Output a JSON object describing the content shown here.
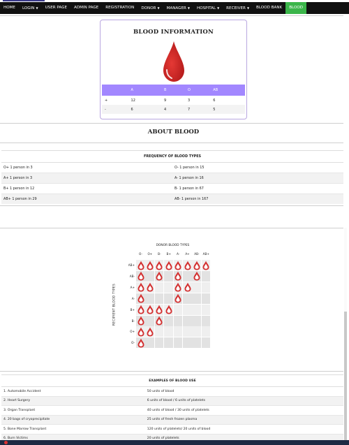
{
  "nav": {
    "items": [
      {
        "label": "HOME",
        "caret": false,
        "active": false
      },
      {
        "label": "LOGIN",
        "caret": true,
        "active": false
      },
      {
        "label": "USER PAGE",
        "caret": false,
        "active": false
      },
      {
        "label": "ADMIN PAGE",
        "caret": false,
        "active": false
      },
      {
        "label": "REGISTRATION",
        "caret": false,
        "active": false
      },
      {
        "label": "DONOR",
        "caret": true,
        "active": false
      },
      {
        "label": "MANAGER",
        "caret": true,
        "active": false
      },
      {
        "label": "HOSPITAL",
        "caret": true,
        "active": false
      },
      {
        "label": "RECEIVER",
        "caret": true,
        "active": false
      },
      {
        "label": "BLOOD BANK",
        "caret": false,
        "active": false
      },
      {
        "label": "BLOOD",
        "caret": false,
        "active": true
      }
    ],
    "active_color": "#3bb54a"
  },
  "info_card": {
    "title": "BLOOD INFORMATION",
    "headers": [
      "",
      "A",
      "B",
      "O",
      "AB"
    ],
    "rows": [
      [
        "+",
        "12",
        "9",
        "3",
        "6"
      ],
      [
        "-",
        "6",
        "4",
        "7",
        "5"
      ]
    ],
    "header_color": "#a287ff"
  },
  "about_title": "ABOUT BLOOD",
  "frequency": {
    "title": "FREQUENCY OF BLOOD TYPES",
    "rows": [
      [
        "O+ 1 person in 3",
        "O- 1 person in 15"
      ],
      [
        "A+ 1 person in 3",
        "A- 1 person in 16"
      ],
      [
        "B+ 1 person in 12",
        "B- 1 person in 67"
      ],
      [
        "AB+ 1 person in 29",
        "AB- 1 person in 167"
      ]
    ]
  },
  "compat": {
    "donor_title": "DONOR BLOOD TYPES",
    "recipient_title": "RECIPIENT BLOOD TYPES",
    "donor_types": [
      "O-",
      "O+",
      "B-",
      "B+",
      "A-",
      "A+",
      "AB-",
      "AB+"
    ],
    "recipient_types": [
      "AB+",
      "AB-",
      "A+",
      "A-",
      "B+",
      "B-",
      "O+",
      "O-"
    ],
    "matrix": [
      [
        1,
        1,
        1,
        1,
        1,
        1,
        1,
        1
      ],
      [
        1,
        0,
        1,
        0,
        1,
        0,
        1,
        0
      ],
      [
        1,
        1,
        0,
        0,
        1,
        1,
        0,
        0
      ],
      [
        1,
        0,
        0,
        0,
        1,
        0,
        0,
        0
      ],
      [
        1,
        1,
        1,
        1,
        0,
        0,
        0,
        0
      ],
      [
        1,
        0,
        1,
        0,
        0,
        0,
        0,
        0
      ],
      [
        1,
        1,
        0,
        0,
        0,
        0,
        0,
        0
      ],
      [
        1,
        0,
        0,
        0,
        0,
        0,
        0,
        0
      ]
    ],
    "drop_color": "#d32f2f"
  },
  "uses": {
    "title": "EXAMPLES OF BLOOD USE",
    "rows": [
      [
        "1. Automobile Accident",
        "50 units of blood"
      ],
      [
        "2. Heart Surgery",
        "6 units of blood / 6 units of platelets"
      ],
      [
        "3. Organ Transplant",
        "40 units of blood / 30 units of platelets"
      ],
      [
        "4. 20 bags of cryoprecipitate",
        "25 units of fresh frozen plasma"
      ],
      [
        "5. Bone Marrow Transplant",
        "120 units of platelets/ 20 units of blood"
      ],
      [
        "6. Burn Victims",
        "20 units of platelets"
      ]
    ]
  }
}
